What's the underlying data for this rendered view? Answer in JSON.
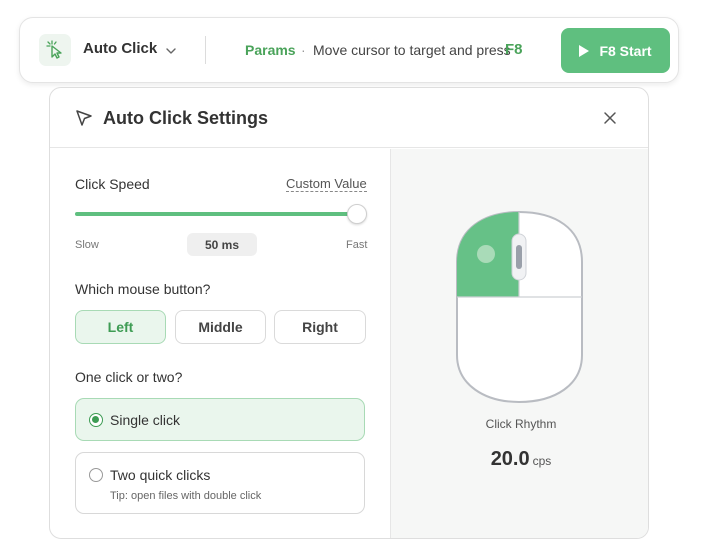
{
  "toolbar": {
    "tool_name": "Auto Click",
    "params_label": "Params",
    "separator": "·",
    "hint": "Move cursor to target and press",
    "hotkey": "F8",
    "start_label": "F8 Start",
    "accent_color": "#5fbf7f",
    "icons": {
      "tool": "cursor-click-icon",
      "dropdown": "chevron-down-icon",
      "start": "play-icon"
    }
  },
  "panel": {
    "title": "Auto Click Settings",
    "icons": {
      "title": "cursor-arrow-icon",
      "close": "close-icon"
    },
    "click_speed": {
      "label": "Click Speed",
      "custom_link": "Custom Value",
      "slow_label": "Slow",
      "fast_label": "Fast",
      "value": "50 ms",
      "slider_position": 1.0
    },
    "mouse_button": {
      "label": "Which mouse button?",
      "options": [
        "Left",
        "Middle",
        "Right"
      ],
      "selected": "Left"
    },
    "click_type": {
      "label": "One click or two?",
      "single": {
        "label": "Single click",
        "selected": true
      },
      "double": {
        "label": "Two quick clicks",
        "tip": "Tip: open files with double click",
        "selected": false
      }
    },
    "preview": {
      "rhythm_label": "Click Rhythm",
      "rhythm_value": "20.0",
      "rhythm_unit": "cps",
      "highlight_button": "Left"
    }
  }
}
